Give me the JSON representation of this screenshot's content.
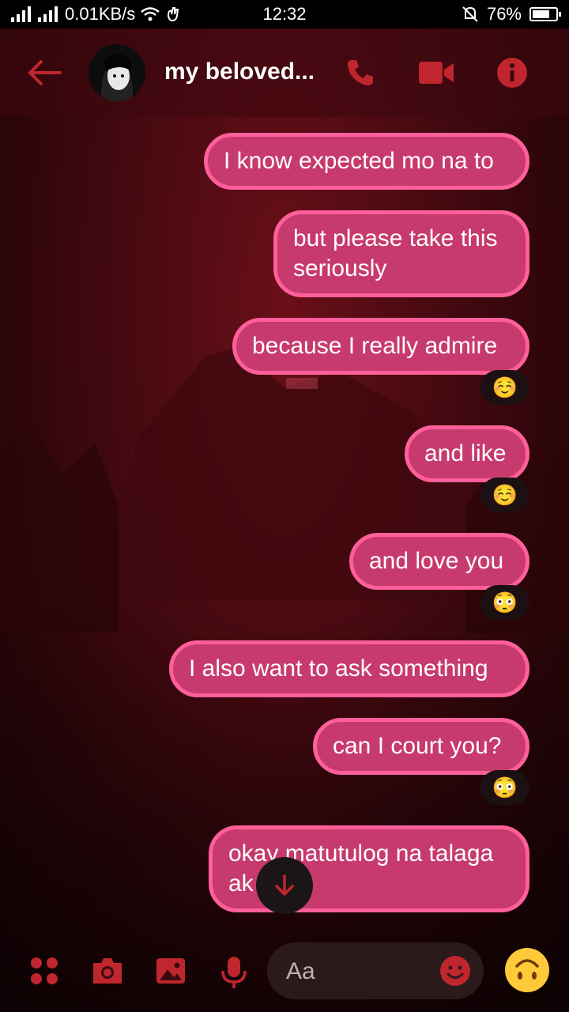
{
  "status_bar": {
    "network_speed": "0.01KB/s",
    "time": "12:32",
    "battery": "76%",
    "battery_level": 0.76
  },
  "header": {
    "contact_name": "my beloved...",
    "back_icon": "arrow-left-icon",
    "call_icon": "phone-icon",
    "video_icon": "video-camera-icon",
    "info_icon": "info-icon"
  },
  "colors": {
    "accent": "#c0262e",
    "bubble_fill": "#c73a6d",
    "bubble_border": "#ff5f9a"
  },
  "messages": [
    {
      "text": "I know expected mo na to",
      "reaction": ""
    },
    {
      "text": "but please take this seriously",
      "reaction": ""
    },
    {
      "text": "because I really admire",
      "reaction": "☺️"
    },
    {
      "text": "and like",
      "reaction": "☺️"
    },
    {
      "text": "and love you",
      "reaction": "😳"
    },
    {
      "text": "I also want to ask something",
      "reaction": ""
    },
    {
      "text": "can I court you?",
      "reaction": "😳"
    },
    {
      "text": "okay matutulog na talaga ak",
      "reaction": ""
    }
  ],
  "composer": {
    "placeholder": "Aa",
    "icons": [
      "apps-grid-icon",
      "camera-icon",
      "image-icon",
      "microphone-icon",
      "emoji-icon",
      "upside-down-face-icon"
    ]
  }
}
